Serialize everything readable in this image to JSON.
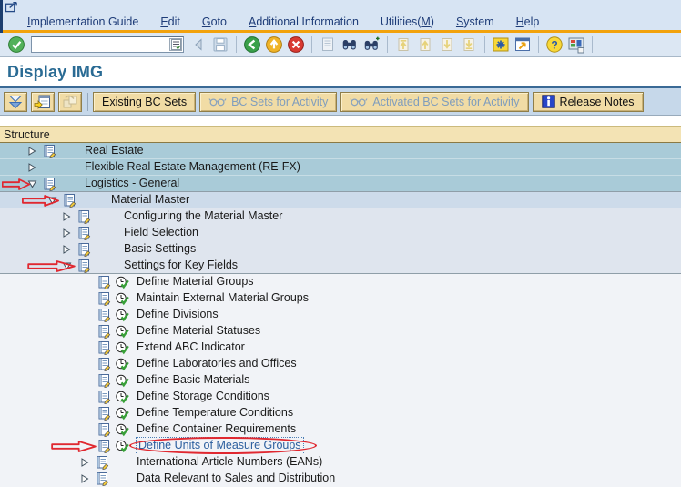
{
  "menu_bar": {
    "items": [
      {
        "label": "Implementation Guide",
        "accel": 0
      },
      {
        "label": "Edit",
        "accel": 0
      },
      {
        "label": "Goto",
        "accel": 0
      },
      {
        "label": "Additional Information",
        "accel": 0
      },
      {
        "label": "Utilities(M)",
        "accel": 10
      },
      {
        "label": "System",
        "accel": 0
      },
      {
        "label": "Help",
        "accel": 0
      }
    ]
  },
  "toolbar": {
    "command_field": {
      "value": "",
      "placeholder": ""
    },
    "enter_icon": "enter-checkmark-icon",
    "command_history_icon": "command-history-icon",
    "icon_groups": [
      [
        {
          "name": "hide-command-field-icon",
          "enabled": false
        },
        {
          "name": "save-icon",
          "enabled": false
        }
      ],
      [
        {
          "name": "back-icon",
          "enabled": true
        },
        {
          "name": "exit-icon",
          "enabled": true
        },
        {
          "name": "cancel-icon",
          "enabled": true
        }
      ],
      [
        {
          "name": "print-icon",
          "enabled": false
        },
        {
          "name": "find-icon",
          "enabled": true
        },
        {
          "name": "find-next-icon",
          "enabled": true
        }
      ],
      [
        {
          "name": "first-page-icon",
          "enabled": false
        },
        {
          "name": "page-up-icon",
          "enabled": false
        },
        {
          "name": "page-down-icon",
          "enabled": false
        },
        {
          "name": "last-page-icon",
          "enabled": false
        }
      ],
      [
        {
          "name": "new-session-icon",
          "enabled": true
        },
        {
          "name": "create-shortcut-icon",
          "enabled": true
        }
      ],
      [
        {
          "name": "help-icon",
          "enabled": true
        },
        {
          "name": "customize-layout-icon",
          "enabled": true
        }
      ]
    ]
  },
  "header": {
    "title": "Display IMG"
  },
  "app_toolbar": {
    "icon_buttons": [
      {
        "name": "expand-subtree-icon",
        "enabled": true
      },
      {
        "name": "position-icon",
        "enabled": true
      },
      {
        "name": "change-request-icon",
        "enabled": false
      }
    ],
    "buttons": [
      {
        "label": "Existing BC Sets",
        "enabled": true,
        "icon": null
      },
      {
        "label": "BC Sets for Activity",
        "enabled": false,
        "icon": "glasses-icon"
      },
      {
        "label": "Activated BC Sets for Activity",
        "enabled": false,
        "icon": "glasses-icon"
      },
      {
        "label": "Release Notes",
        "enabled": true,
        "icon": "info-icon"
      }
    ]
  },
  "tree": {
    "header": "Structure",
    "rows": [
      {
        "label": "Real Estate",
        "kind": "group",
        "state": "collapsed",
        "doc": true,
        "level": 1,
        "block": "l1"
      },
      {
        "label": "Flexible Real Estate Management (RE-FX)",
        "kind": "group",
        "state": "collapsed",
        "doc": false,
        "level": 1,
        "block": "l1"
      },
      {
        "label": "Logistics - General",
        "kind": "group",
        "state": "expanded",
        "doc": true,
        "level": 1,
        "block": "l1",
        "red_arrow": true,
        "divider": true
      },
      {
        "label": "Material Master",
        "kind": "group",
        "state": "expanded",
        "doc": true,
        "level": 2,
        "block": "l2",
        "red_arrow": true,
        "divider": true
      },
      {
        "label": "Configuring the Material Master",
        "kind": "group",
        "state": "collapsed",
        "doc": true,
        "level": 3,
        "block": "l3"
      },
      {
        "label": "Field Selection",
        "kind": "group",
        "state": "collapsed",
        "doc": true,
        "level": 3,
        "block": "l3"
      },
      {
        "label": "Basic Settings",
        "kind": "group",
        "state": "collapsed",
        "doc": true,
        "level": 3,
        "block": "l3"
      },
      {
        "label": "Settings for Key Fields",
        "kind": "group",
        "state": "expanded",
        "doc": true,
        "level": 3,
        "block": "l3",
        "red_arrow": true,
        "divider": true
      },
      {
        "label": "Define Material Groups",
        "kind": "activity",
        "block": "l4"
      },
      {
        "label": "Maintain External Material Groups",
        "kind": "activity",
        "block": "l4"
      },
      {
        "label": "Define Divisions",
        "kind": "activity",
        "block": "l4"
      },
      {
        "label": "Define Material Statuses",
        "kind": "activity",
        "block": "l4"
      },
      {
        "label": "Extend ABC Indicator",
        "kind": "activity",
        "block": "l4"
      },
      {
        "label": "Define Laboratories and Offices",
        "kind": "activity",
        "block": "l4"
      },
      {
        "label": "Define Basic Materials",
        "kind": "activity",
        "block": "l4"
      },
      {
        "label": "Define Storage Conditions",
        "kind": "activity",
        "block": "l4"
      },
      {
        "label": "Define Temperature Conditions",
        "kind": "activity",
        "block": "l4"
      },
      {
        "label": "Define Container Requirements",
        "kind": "activity",
        "block": "l4"
      },
      {
        "label": "Define Units of Measure Groups",
        "kind": "activity",
        "block": "l4",
        "red_arrow": true,
        "highlighted": true
      },
      {
        "label": "International Article Numbers (EANs)",
        "kind": "group",
        "state": "collapsed",
        "doc": true,
        "level": 4,
        "block": "l4"
      },
      {
        "label": "Data Relevant to Sales and Distribution",
        "kind": "group",
        "state": "collapsed",
        "doc": true,
        "level": 4,
        "block": "l4"
      }
    ]
  },
  "annotations": {
    "color": "#e02830",
    "highlighted_item": "Define Units of Measure Groups",
    "arrow_rows": [
      "Logistics - General",
      "Material Master",
      "Settings for Key Fields",
      "Define Units of Measure Groups"
    ]
  },
  "colors": {
    "accent_orange": "#f2a20c",
    "title_color": "#2a6b94",
    "level1_bg": "#a9cbd8",
    "level2_bg": "#cddbea",
    "level3_bg": "#dfe5ee",
    "level4_bg": "#f1f3f7",
    "structure_bar_bg": "#f3e3b4",
    "button_bg": "#f1dca5",
    "selected_text": "#2b5e9e"
  }
}
